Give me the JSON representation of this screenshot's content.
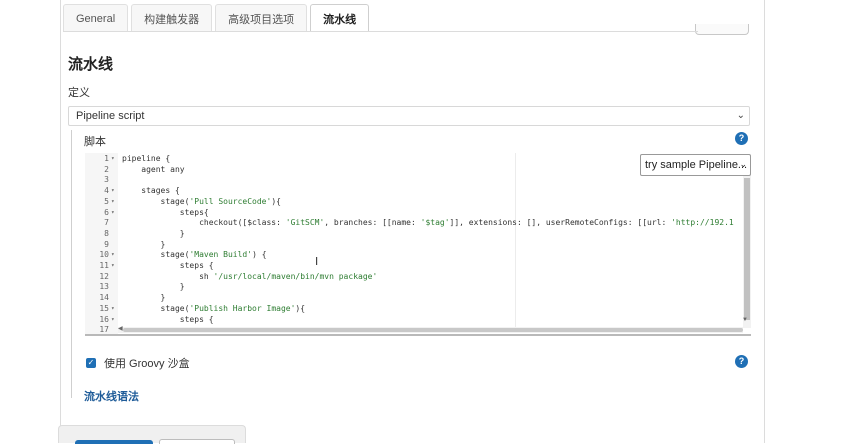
{
  "tabs": [
    {
      "label": "General",
      "active": false
    },
    {
      "label": "构建触发器",
      "active": false
    },
    {
      "label": "高级项目选项",
      "active": false
    },
    {
      "label": "流水线",
      "active": true
    }
  ],
  "section": {
    "title": "流水线",
    "definition_label": "定义",
    "definition_value": "Pipeline script"
  },
  "script": {
    "label": "脚本",
    "help_icon": "question-circle-icon",
    "sample_select": "try sample Pipeline...",
    "lines": [
      {
        "n": "1",
        "fold": true,
        "parts": [
          {
            "t": "pipeline {"
          }
        ]
      },
      {
        "n": "2",
        "fold": false,
        "parts": [
          {
            "t": "    agent any"
          }
        ]
      },
      {
        "n": "3",
        "fold": false,
        "parts": [
          {
            "t": ""
          }
        ]
      },
      {
        "n": "4",
        "fold": true,
        "parts": [
          {
            "t": "    stages {"
          }
        ]
      },
      {
        "n": "5",
        "fold": true,
        "parts": [
          {
            "t": "        stage("
          },
          {
            "t": "'Pull SourceCode'",
            "s": true
          },
          {
            "t": "){"
          }
        ]
      },
      {
        "n": "6",
        "fold": true,
        "parts": [
          {
            "t": "            steps{"
          }
        ]
      },
      {
        "n": "7",
        "fold": false,
        "parts": [
          {
            "t": "                checkout([$class: "
          },
          {
            "t": "'GitSCM'",
            "s": true
          },
          {
            "t": ", branches: [[name: "
          },
          {
            "t": "'$tag'",
            "s": true
          },
          {
            "t": "]], extensions: [], userRemoteConfigs: [[url: "
          },
          {
            "t": "'http://192.1",
            "s": true
          }
        ]
      },
      {
        "n": "8",
        "fold": false,
        "parts": [
          {
            "t": "            }"
          }
        ]
      },
      {
        "n": "9",
        "fold": false,
        "parts": [
          {
            "t": "        }"
          }
        ]
      },
      {
        "n": "10",
        "fold": true,
        "parts": [
          {
            "t": "        stage("
          },
          {
            "t": "'Maven Build'",
            "s": true
          },
          {
            "t": ") {"
          }
        ]
      },
      {
        "n": "11",
        "fold": true,
        "parts": [
          {
            "t": "            steps {"
          }
        ]
      },
      {
        "n": "12",
        "fold": false,
        "parts": [
          {
            "t": "                sh "
          },
          {
            "t": "'/usr/local/maven/bin/mvn package'",
            "s": true
          }
        ]
      },
      {
        "n": "13",
        "fold": false,
        "parts": [
          {
            "t": "            }"
          }
        ]
      },
      {
        "n": "14",
        "fold": false,
        "parts": [
          {
            "t": "        }"
          }
        ]
      },
      {
        "n": "15",
        "fold": true,
        "parts": [
          {
            "t": "        stage("
          },
          {
            "t": "'Publish Harbor Image'",
            "s": true
          },
          {
            "t": "){"
          }
        ]
      },
      {
        "n": "16",
        "fold": true,
        "parts": [
          {
            "t": "            steps {"
          }
        ]
      },
      {
        "n": "17",
        "fold": false,
        "parts": [
          {
            "t": ""
          }
        ]
      }
    ]
  },
  "groovy": {
    "label": "使用 Groovy 沙盒",
    "checked": true
  },
  "syntax_link": "流水线语法",
  "colors": {
    "accent": "#1f6fb5",
    "string": "#2e7d32",
    "link": "#1f5c99"
  }
}
